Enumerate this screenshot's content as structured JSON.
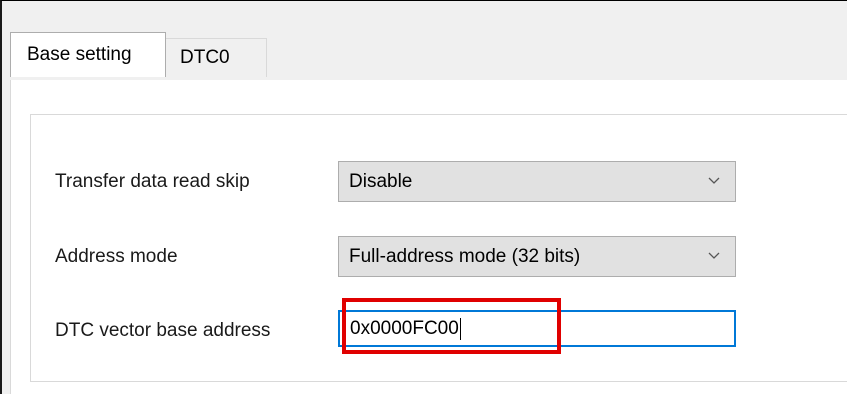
{
  "tabs": [
    {
      "label": "Base setting",
      "active": true
    },
    {
      "label": "DTC0",
      "active": false
    }
  ],
  "form": {
    "transfer_skip": {
      "label": "Transfer data read skip",
      "value": "Disable"
    },
    "address_mode": {
      "label": "Address mode",
      "value": "Full-address mode (32 bits)"
    },
    "vector_base": {
      "label": "DTC vector base address",
      "value": "0x0000FC00"
    }
  },
  "colors": {
    "highlight": "#e00000",
    "focus_border": "#0078d7",
    "combo_bg": "#e1e1e1"
  },
  "icons": {
    "dropdown": "chevron-down-icon"
  }
}
